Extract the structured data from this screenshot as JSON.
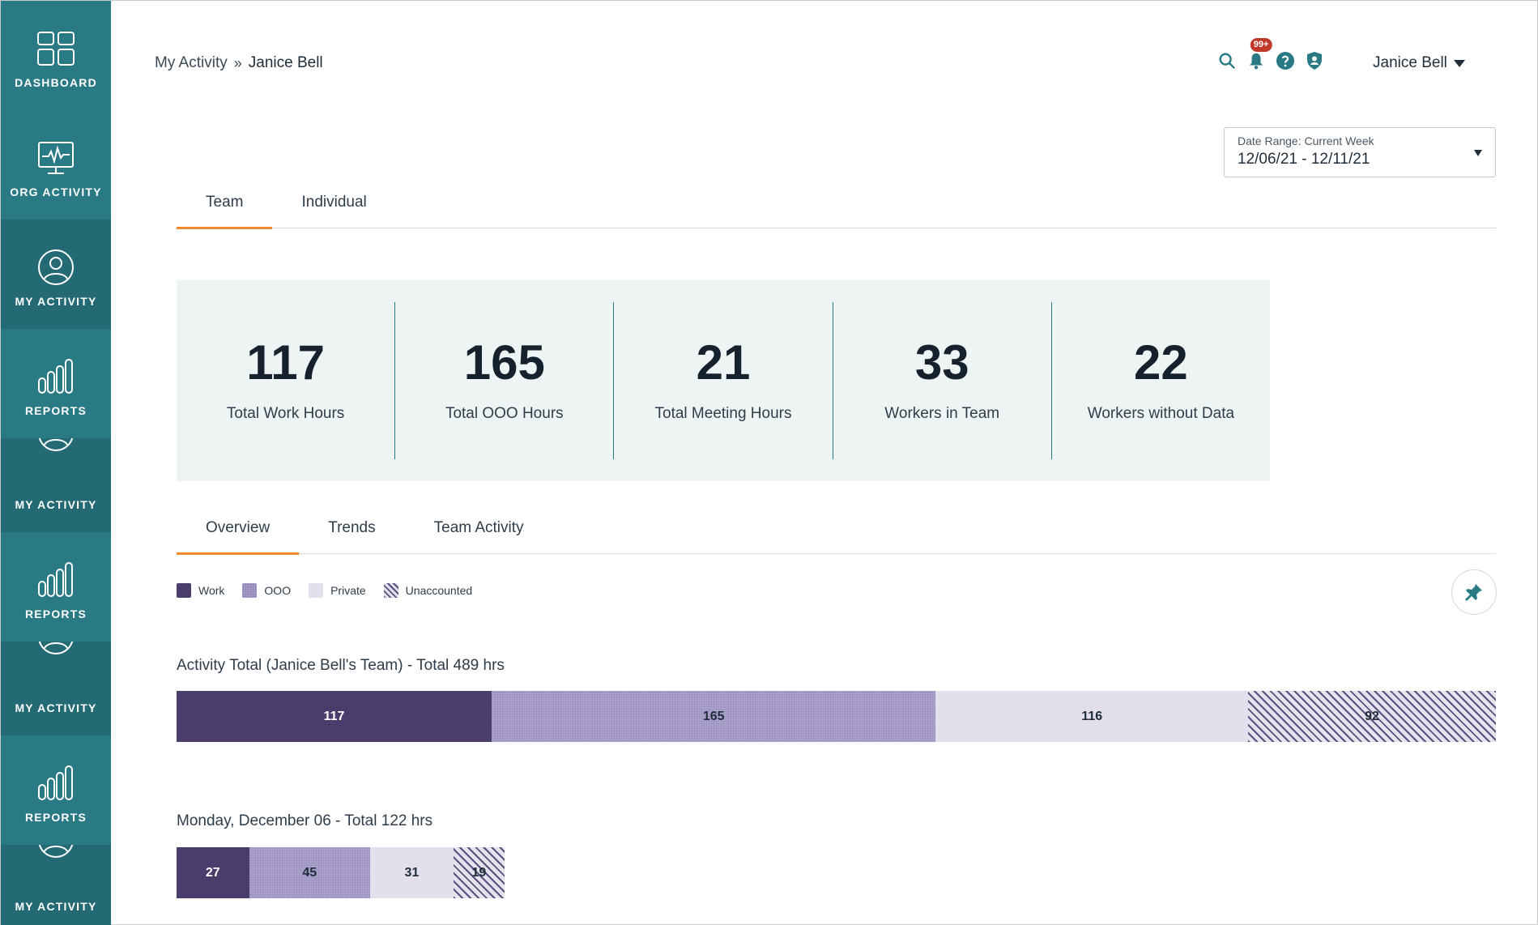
{
  "sidebar": {
    "items": [
      {
        "label": "DASHBOARD",
        "icon": "dashboard-icon"
      },
      {
        "label": "ORG ACTIVITY",
        "icon": "monitor-pulse-icon"
      },
      {
        "label": "MY ACTIVITY",
        "icon": "user-icon"
      },
      {
        "label": "REPORTS",
        "icon": "bar-chart-icon"
      },
      {
        "label": "MY ACTIVITY",
        "icon": "user-icon"
      },
      {
        "label": "REPORTS",
        "icon": "bar-chart-icon"
      },
      {
        "label": "MY ACTIVITY",
        "icon": "user-icon"
      },
      {
        "label": "REPORTS",
        "icon": "bar-chart-icon"
      },
      {
        "label": "MY ACTIVITY",
        "icon": "user-icon"
      }
    ]
  },
  "breadcrumb": {
    "parent": "My Activity",
    "separator": "»",
    "current": "Janice Bell"
  },
  "header": {
    "notification_badge": "99+",
    "user_name": "Janice Bell"
  },
  "date_range": {
    "label": "Date Range: Current Week",
    "value": "12/06/21 - 12/11/21"
  },
  "top_tabs": [
    {
      "label": "Team",
      "active": true
    },
    {
      "label": "Individual",
      "active": false
    }
  ],
  "stats": [
    {
      "value": "117",
      "label": "Total Work Hours"
    },
    {
      "value": "165",
      "label": "Total OOO Hours"
    },
    {
      "value": "21",
      "label": "Total Meeting Hours"
    },
    {
      "value": "33",
      "label": "Workers in Team"
    },
    {
      "value": "22",
      "label": "Workers without Data"
    }
  ],
  "sub_tabs": [
    {
      "label": "Overview",
      "active": true
    },
    {
      "label": "Trends",
      "active": false
    },
    {
      "label": "Team Activity",
      "active": false
    }
  ],
  "legend": [
    {
      "label": "Work",
      "kind": "work"
    },
    {
      "label": "OOO",
      "kind": "ooo"
    },
    {
      "label": "Private",
      "kind": "private"
    },
    {
      "label": "Unaccounted",
      "kind": "unaccounted"
    }
  ],
  "colors": {
    "accent": "#f0892e",
    "sidebar": "#2a7a86",
    "work": "#4a3d6b",
    "ooo": "#b1a8cf",
    "private": "#e3dfec"
  },
  "activity_total": {
    "title": "Activity Total (Janice Bell's Team) - Total 489 hrs",
    "segments": [
      {
        "kind": "work",
        "value": "117"
      },
      {
        "kind": "ooo",
        "value": "165"
      },
      {
        "kind": "private",
        "value": "116"
      },
      {
        "kind": "unaccounted",
        "value": "92"
      }
    ]
  },
  "day_monday": {
    "title": "Monday, December 06 - Total 122 hrs",
    "segments": [
      {
        "kind": "work",
        "value": "27"
      },
      {
        "kind": "ooo",
        "value": "45"
      },
      {
        "kind": "private",
        "value": "31"
      },
      {
        "kind": "unaccounted",
        "value": "19"
      }
    ]
  }
}
